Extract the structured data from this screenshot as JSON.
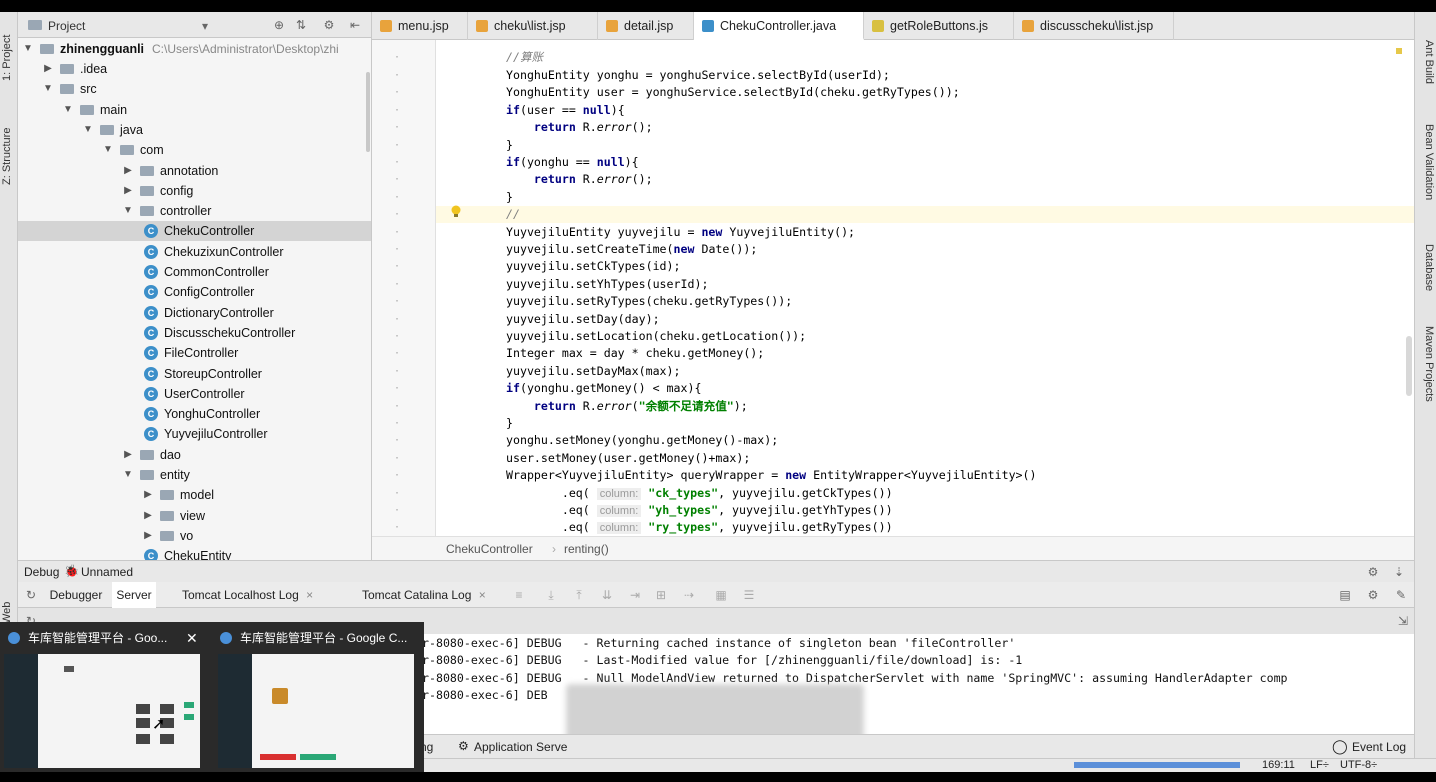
{
  "left_strip": {
    "project": "1: Project",
    "structure": "Z: Structure",
    "web": "Web"
  },
  "right_strip": {
    "ant": "Ant Build",
    "bean": "Bean Validation",
    "database": "Database",
    "maven": "Maven Projects"
  },
  "project_panel": {
    "title": "Project",
    "root": {
      "name": "zhinengguanli",
      "path": "C:\\Users\\Administrator\\Desktop\\zhi"
    },
    "tree": [
      {
        "label": ".idea",
        "kind": "folder",
        "depth": 1,
        "arrow": "right"
      },
      {
        "label": "src",
        "kind": "folder",
        "depth": 1,
        "arrow": "down"
      },
      {
        "label": "main",
        "kind": "folder",
        "depth": 2,
        "arrow": "down"
      },
      {
        "label": "java",
        "kind": "folder",
        "depth": 3,
        "arrow": "down"
      },
      {
        "label": "com",
        "kind": "folder",
        "depth": 4,
        "arrow": "down"
      },
      {
        "label": "annotation",
        "kind": "folder",
        "depth": 5,
        "arrow": "right"
      },
      {
        "label": "config",
        "kind": "folder",
        "depth": 5,
        "arrow": "right"
      },
      {
        "label": "controller",
        "kind": "folder",
        "depth": 5,
        "arrow": "down"
      },
      {
        "label": "ChekuController",
        "kind": "class",
        "depth": 6,
        "selected": true
      },
      {
        "label": "ChekuzixunController",
        "kind": "class",
        "depth": 6
      },
      {
        "label": "CommonController",
        "kind": "class",
        "depth": 6
      },
      {
        "label": "ConfigController",
        "kind": "class",
        "depth": 6
      },
      {
        "label": "DictionaryController",
        "kind": "class",
        "depth": 6
      },
      {
        "label": "DiscusschekuController",
        "kind": "class",
        "depth": 6
      },
      {
        "label": "FileController",
        "kind": "class",
        "depth": 6
      },
      {
        "label": "StoreupController",
        "kind": "class",
        "depth": 6
      },
      {
        "label": "UserController",
        "kind": "class",
        "depth": 6
      },
      {
        "label": "YonghuController",
        "kind": "class",
        "depth": 6
      },
      {
        "label": "YuyvejiluController",
        "kind": "class",
        "depth": 6
      },
      {
        "label": "dao",
        "kind": "folder",
        "depth": 5,
        "arrow": "right"
      },
      {
        "label": "entity",
        "kind": "folder",
        "depth": 5,
        "arrow": "down"
      },
      {
        "label": "model",
        "kind": "folder",
        "depth": 6,
        "arrow": "right"
      },
      {
        "label": "view",
        "kind": "folder",
        "depth": 6,
        "arrow": "right"
      },
      {
        "label": "vo",
        "kind": "folder",
        "depth": 6,
        "arrow": "right"
      },
      {
        "label": "ChekuEntity",
        "kind": "class",
        "depth": 6
      }
    ]
  },
  "editor_tabs": [
    {
      "label": "menu.jsp",
      "color": "#e8a33c"
    },
    {
      "label": "cheku\\list.jsp",
      "color": "#e8a33c"
    },
    {
      "label": "detail.jsp",
      "color": "#e8a33c"
    },
    {
      "label": "ChekuController.java",
      "color": "#3c8fc9",
      "active": true
    },
    {
      "label": "getRoleButtons.js",
      "color": "#d8c040"
    },
    {
      "label": "discusscheku\\list.jsp",
      "color": "#e8a33c"
    }
  ],
  "code": {
    "comment_top": "//算账",
    "lines": [
      "YonghuEntity yonghu = yonghuService.selectById(userId);",
      "YonghuEntity user = yonghuService.selectById(cheku.getRyTypes());",
      "if(user == null){",
      "    return R.error();",
      "}",
      "if(yonghu == null){",
      "    return R.error();",
      "}",
      "//",
      "YuyvejiluEntity yuyvejilu = new YuyvejiluEntity();",
      "yuyvejilu.setCreateTime(new Date());",
      "yuyvejilu.setCkTypes(id);",
      "yuyvejilu.setYhTypes(userId);",
      "yuyvejilu.setRyTypes(cheku.getRyTypes());",
      "yuyvejilu.setDay(day);",
      "yuyvejilu.setLocation(cheku.getLocation());",
      "Integer max = day * cheku.getMoney();",
      "yuyvejilu.setDayMax(max);",
      "if(yonghu.getMoney() < max){",
      "    return R.error(\"余额不足请充值\");",
      "}",
      "yonghu.setMoney(yonghu.getMoney()-max);",
      "user.setMoney(user.getMoney()+max);",
      "Wrapper<YuyvejiluEntity> queryWrapper = new EntityWrapper<YuyvejiluEntity>()"
    ],
    "hint": "column:",
    "eq_lines": [
      {
        "col": "\"ck_types\"",
        "rest": ", yuyvejilu.getCkTypes())"
      },
      {
        "col": "\"yh_types\"",
        "rest": ", yuyvejilu.getYhTypes())"
      },
      {
        "col": "\"ry_types\"",
        "rest": ", yuyvejilu.getRyTypes())"
      }
    ],
    "error_msg": "\"余额不足请充值\""
  },
  "breadcrumb": {
    "class": "ChekuController",
    "method": "renting()"
  },
  "debug": {
    "title": "Debug",
    "config": "Unnamed",
    "tabs": [
      "Debugger",
      "Server",
      "Tomcat Localhost Log",
      "Tomcat Catalina Log"
    ],
    "log": [
      "r-8080-exec-6] DEBUG   - Returning cached instance of singleton bean 'fileController'",
      "r-8080-exec-6] DEBUG   - Last-Modified value for [/zhinengguanli/file/download] is: -1",
      "r-8080-exec-6] DEBUG   - Null ModelAndView returned to DispatcherServlet with name 'SpringMVC': assuming HandlerAdapter comp",
      "r-8080-exec-6] DEB"
    ]
  },
  "bottom_tools": {
    "left_fragment": "ng",
    "app_server": "Application Serve",
    "event_log": "Event Log"
  },
  "status": {
    "position": "169:11",
    "lf": "LF÷",
    "encoding": "UTF-8÷"
  },
  "preview": {
    "items": [
      {
        "title": "车库智能管理平台 - Goo..."
      },
      {
        "title": "车库智能管理平台 - Google C..."
      }
    ],
    "close": "✕"
  }
}
